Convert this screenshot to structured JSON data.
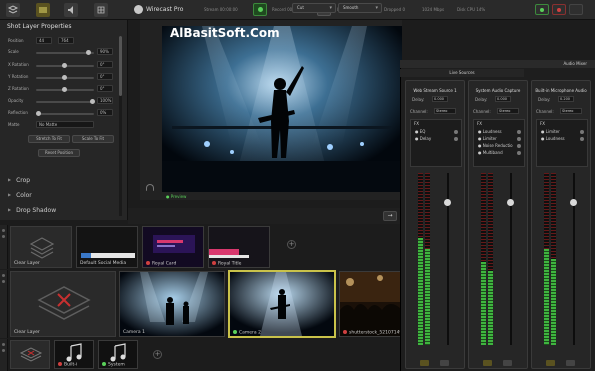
{
  "app": {
    "title": "Wirecast Pro",
    "watermark": "AlBasitSoft.Com"
  },
  "toolbar": {
    "stats": [
      {
        "label": "Stream",
        "value": "00:00:00"
      },
      {
        "label": "Record",
        "value": "00:00:00"
      },
      {
        "label": "ISO",
        "value": "00:00:00"
      },
      {
        "label": "Dropped",
        "value": "0"
      },
      {
        "label": "CPU",
        "value": "1024 Mbps"
      },
      {
        "label": "Disk CPU",
        "value": "14%"
      }
    ]
  },
  "properties": {
    "title": "Shot Layer Properties",
    "position_label": "Position",
    "position_x": "44",
    "position_y": "764",
    "scale_label": "Scale",
    "scale_value": "90%",
    "x_rotation_label": "X Rotation",
    "x_rotation_value": "0°",
    "y_rotation_label": "Y Rotation",
    "y_rotation_value": "0°",
    "z_rotation_label": "Z Rotation",
    "z_rotation_value": "0°",
    "opacity_label": "Opacity",
    "opacity_value": "100%",
    "reflection_label": "Reflection",
    "reflection_value": "0%",
    "matte_label": "Matte",
    "matte_value": "No Matte",
    "stretch_button": "Stretch To Fit",
    "scale_button": "Scale To Fit",
    "reset_button": "Reset Position",
    "sections": [
      "Crop",
      "Color",
      "Drop Shadow"
    ]
  },
  "preview": {
    "label": "Preview"
  },
  "transition": {
    "cut": "Cut",
    "smooth": "Smooth"
  },
  "scenes": {
    "row1": [
      {
        "label": "Clear Layer"
      },
      {
        "label": "Default Social Media"
      },
      {
        "label": "Royal Card"
      },
      {
        "label": "Royal Title"
      }
    ],
    "row2": [
      {
        "label": "Clear Layer"
      },
      {
        "label": "Camera 1"
      },
      {
        "label": "Camera 2"
      },
      {
        "label": "shutterstock_52107149"
      }
    ],
    "row3": [
      {
        "label": ""
      },
      {
        "label": "Built-i"
      },
      {
        "label": "System"
      }
    ]
  },
  "mixer": {
    "title": "Audio Mixer",
    "tab": "Live Sources",
    "strips": [
      {
        "name": "Web Stream Source 1",
        "delay_label": "Delay:",
        "delay": "0.000",
        "channel_label": "Channel:",
        "channel": "Stereo",
        "fx_label": "FX",
        "fx": [
          "EQ",
          "Delay"
        ],
        "level": 0.62,
        "fader": 0.83
      },
      {
        "name": "System Audio Capture",
        "delay_label": "Delay:",
        "delay": "0.000",
        "channel_label": "Channel:",
        "channel": "Stereo",
        "fx_label": "FX",
        "fx": [
          "Loudness",
          "Limiter",
          "Noise Reductio",
          "Multiband"
        ],
        "level": 0.48,
        "fader": 0.83
      },
      {
        "name": "Built-in Microphone Audio",
        "delay_label": "Delay:",
        "delay": "0.200",
        "channel_label": "Channel:",
        "channel": "Stereo",
        "fx_label": "FX",
        "fx": [
          "Limiter",
          "Loudness"
        ],
        "level": 0.56,
        "fader": 0.83
      }
    ]
  },
  "colors": {
    "accent": "#c9c24a",
    "live_green": "#5ad05a",
    "rec_red": "#d04040",
    "meter_green": "#3fb43f"
  }
}
